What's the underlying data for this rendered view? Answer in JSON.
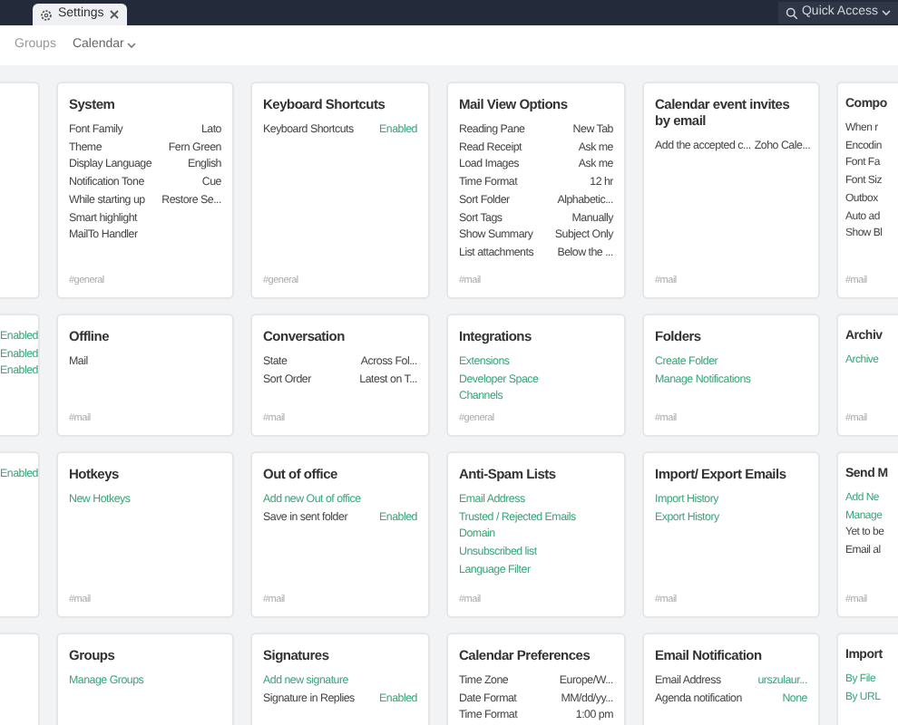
{
  "tabs": [
    {
      "label": "Settings",
      "selected": true
    }
  ],
  "quick_access": {
    "label": "Quick Access"
  },
  "subnav": [
    {
      "label": "Groups",
      "has_menu": false
    },
    {
      "label": "Calendar",
      "has_menu": true
    }
  ],
  "grid_rows": [
    {
      "cards": [
        {
          "kind": "leftcut"
        },
        {
          "kind": "full",
          "title": "System",
          "items": [
            {
              "kind": "setting",
              "label": "Font Family",
              "value": "Lato"
            },
            {
              "kind": "setting",
              "label": "Theme",
              "value": "Fern Green"
            },
            {
              "kind": "setting",
              "label": "Display Language",
              "value": "English"
            },
            {
              "kind": "setting",
              "label": "Notification Tone",
              "value": "Cue"
            },
            {
              "kind": "setting",
              "label": "While starting up",
              "value": "Restore Se..."
            },
            {
              "kind": "setting",
              "label": "Smart highlight"
            },
            {
              "kind": "setting",
              "label": "MailTo Handler"
            }
          ],
          "tag": "#general"
        },
        {
          "kind": "full",
          "title": "Keyboard Shortcuts",
          "items": [
            {
              "kind": "toggle",
              "label": "Keyboard Shortcuts",
              "value": "Enabled"
            }
          ],
          "tag": "#general"
        },
        {
          "kind": "full",
          "title": "Mail View Options",
          "items": [
            {
              "kind": "setting",
              "label": "Reading Pane",
              "value": "New Tab"
            },
            {
              "kind": "setting",
              "label": "Read Receipt",
              "value": "Ask me"
            },
            {
              "kind": "setting",
              "label": "Load Images",
              "value": "Ask me"
            },
            {
              "kind": "setting",
              "label": "Time Format",
              "value": "12 hr"
            },
            {
              "kind": "setting",
              "label": "Sort Folder",
              "value": "Alphabetic..."
            },
            {
              "kind": "setting",
              "label": "Sort Tags",
              "value": "Manually"
            },
            {
              "kind": "setting",
              "label": "Show Summary",
              "value": "Subject Only"
            },
            {
              "kind": "setting",
              "label": "List attachments",
              "value": "Below the ..."
            }
          ],
          "tag": "#mail"
        },
        {
          "kind": "full",
          "title": "Calendar event invites by email",
          "items": [
            {
              "kind": "setting",
              "label": "Add the accepted c...",
              "value": "Zoho Cale..."
            }
          ],
          "tag": "#mail"
        },
        {
          "kind": "rightcut",
          "title": "Compo",
          "items": [
            {
              "kind": "setting",
              "label": "When r"
            },
            {
              "kind": "setting",
              "label": "Encodin"
            },
            {
              "kind": "setting",
              "label": "Font Fa"
            },
            {
              "kind": "setting",
              "label": "Font Siz"
            },
            {
              "kind": "setting",
              "label": "Outbox"
            },
            {
              "kind": "setting",
              "label": "Auto ad"
            },
            {
              "kind": "setting",
              "label": "Show Bl"
            }
          ],
          "tag": "#mail"
        }
      ]
    },
    {
      "cards": [
        {
          "kind": "leftcut",
          "items": [
            {
              "kind": "toggle",
              "value": "Enabled"
            },
            {
              "kind": "toggle",
              "value": "Enabled"
            },
            {
              "kind": "toggle",
              "value": "Enabled"
            }
          ]
        },
        {
          "kind": "full",
          "title": "Offline",
          "items": [
            {
              "kind": "setting",
              "label": "Mail"
            }
          ],
          "tag": "#mail"
        },
        {
          "kind": "full",
          "title": "Conversation",
          "items": [
            {
              "kind": "setting",
              "label": "State",
              "value": "Across Fol..."
            },
            {
              "kind": "setting",
              "label": "Sort Order",
              "value": "Latest on T..."
            }
          ],
          "tag": "#mail"
        },
        {
          "kind": "full",
          "title": "Integrations",
          "items": [
            {
              "kind": "link",
              "label": "Extensions"
            },
            {
              "kind": "link",
              "label": "Developer Space"
            },
            {
              "kind": "link",
              "label": "Channels"
            }
          ],
          "tag": "#general"
        },
        {
          "kind": "full",
          "title": "Folders",
          "items": [
            {
              "kind": "link",
              "label": "Create Folder"
            },
            {
              "kind": "link",
              "label": "Manage Notifications"
            }
          ],
          "tag": "#mail"
        },
        {
          "kind": "rightcut",
          "title": "Archiv",
          "items": [
            {
              "kind": "link",
              "label": "Archive"
            }
          ],
          "tag": "#mail"
        }
      ]
    },
    {
      "cards": [
        {
          "kind": "leftcut",
          "items": [
            {
              "kind": "toggle",
              "value": "Enabled"
            }
          ]
        },
        {
          "kind": "full",
          "title": "Hotkeys",
          "items": [
            {
              "kind": "link",
              "label": "New Hotkeys"
            }
          ],
          "tag": "#mail"
        },
        {
          "kind": "full",
          "title": "Out of office",
          "items": [
            {
              "kind": "link",
              "label": "Add new Out of office"
            },
            {
              "kind": "toggle",
              "label": "Save in sent folder",
              "value": "Enabled"
            }
          ],
          "tag": "#mail"
        },
        {
          "kind": "full",
          "title": "Anti-Spam Lists",
          "items": [
            {
              "kind": "link",
              "label": "Email Address"
            },
            {
              "kind": "link",
              "label": "Trusted / Rejected Emails"
            },
            {
              "kind": "link",
              "label": "Domain"
            },
            {
              "kind": "link",
              "label": "Unsubscribed list"
            },
            {
              "kind": "link",
              "label": "Language Filter"
            }
          ],
          "tag": "#mail"
        },
        {
          "kind": "full",
          "title": "Import/ Export Emails",
          "items": [
            {
              "kind": "link",
              "label": "Import History"
            },
            {
              "kind": "link",
              "label": "Export History"
            }
          ],
          "tag": "#mail"
        },
        {
          "kind": "rightcut",
          "title": "Send M",
          "items": [
            {
              "kind": "link",
              "label": "Add Ne"
            },
            {
              "kind": "link",
              "label": "Manage"
            },
            {
              "kind": "setting",
              "label": "Yet to be"
            },
            {
              "kind": "setting",
              "label": "Email al"
            }
          ],
          "tag": "#mail"
        }
      ]
    },
    {
      "cards": [
        {
          "kind": "leftcut"
        },
        {
          "kind": "full",
          "title": "Groups",
          "items": [
            {
              "kind": "link",
              "label": "Manage Groups"
            }
          ]
        },
        {
          "kind": "full",
          "title": "Signatures",
          "items": [
            {
              "kind": "link",
              "label": "Add new signature"
            },
            {
              "kind": "toggle",
              "label": "Signature in Replies",
              "value": "Enabled"
            }
          ]
        },
        {
          "kind": "full",
          "title": "Calendar Preferences",
          "items": [
            {
              "kind": "setting",
              "label": "Time Zone",
              "value": "Europe/W..."
            },
            {
              "kind": "setting",
              "label": "Date Format",
              "value": "MM/dd/yy..."
            },
            {
              "kind": "setting",
              "label": "Time Format",
              "value": "1:00 pm"
            }
          ]
        },
        {
          "kind": "full",
          "title": "Email Notification",
          "items": [
            {
              "kind": "toggle",
              "label": "Email Address",
              "value": "urszulaur..."
            },
            {
              "kind": "toggle",
              "label": "Agenda notification",
              "value": "None"
            }
          ]
        },
        {
          "kind": "rightcut",
          "title": "Import",
          "items": [
            {
              "kind": "link",
              "label": "By File"
            },
            {
              "kind": "link",
              "label": "By URL"
            }
          ]
        }
      ]
    }
  ]
}
